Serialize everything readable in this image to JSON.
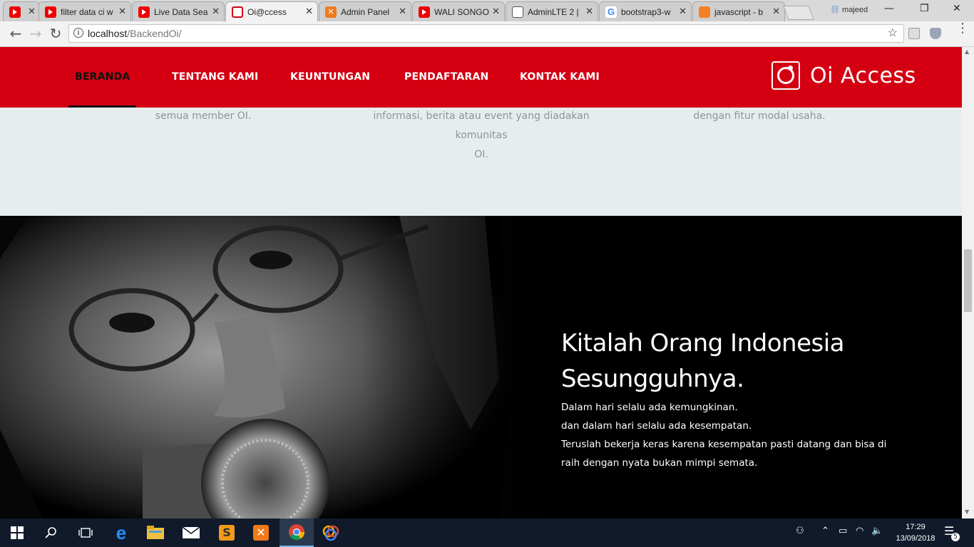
{
  "browser": {
    "tabs": [
      {
        "title": "",
        "favicon": "youtube-icon",
        "active": false
      },
      {
        "title": "filter data ci w",
        "favicon": "youtube-icon",
        "active": false
      },
      {
        "title": "Live Data Sea",
        "favicon": "youtube-icon",
        "active": false
      },
      {
        "title": "Oi@ccess",
        "favicon": "oi-icon",
        "active": true
      },
      {
        "title": "Admin Panel",
        "favicon": "xampp-icon",
        "active": false
      },
      {
        "title": "WALI SONGO",
        "favicon": "youtube-icon",
        "active": false
      },
      {
        "title": "AdminLTE 2 |",
        "favicon": "document-icon",
        "active": false
      },
      {
        "title": "bootstrap3-w",
        "favicon": "google-icon",
        "active": false
      },
      {
        "title": "javascript - b",
        "favicon": "stackoverflow-icon",
        "active": false
      }
    ],
    "profile_name": "majeed",
    "url_host": "localhost",
    "url_path": "/BackendOi/"
  },
  "nav": {
    "items": [
      "BERANDA",
      "TENTANG KAMI",
      "KEUNTUNGAN",
      "PENDAFTARAN",
      "KONTAK KAMI"
    ],
    "active_index": 0,
    "brand": "Oi Access"
  },
  "features": {
    "col1": "semua member OI.",
    "col2_line1": "informasi, berita atau event yang diadakan komunitas",
    "col2_line2": "OI.",
    "col3": "dengan fitur modal usaha."
  },
  "hero": {
    "title_line1": "Kitalah Orang Indonesia",
    "title_line2": "Sesungguhnya.",
    "body": [
      "Dalam hari selalu ada kemungkinan.",
      "dan dalam hari selalu ada kesempatan.",
      "Teruslah bekerja keras karena kesempatan pasti datang dan bisa di",
      "raih dengan nyata bukan mimpi semata."
    ]
  },
  "taskbar": {
    "time": "17:29",
    "date": "13/09/2018",
    "notification_count": "5"
  },
  "colors": {
    "brand_red": "#d40012",
    "section_bg": "#e6eded",
    "hero_bg": "#000000",
    "taskbar_bg": "#101a2b"
  }
}
